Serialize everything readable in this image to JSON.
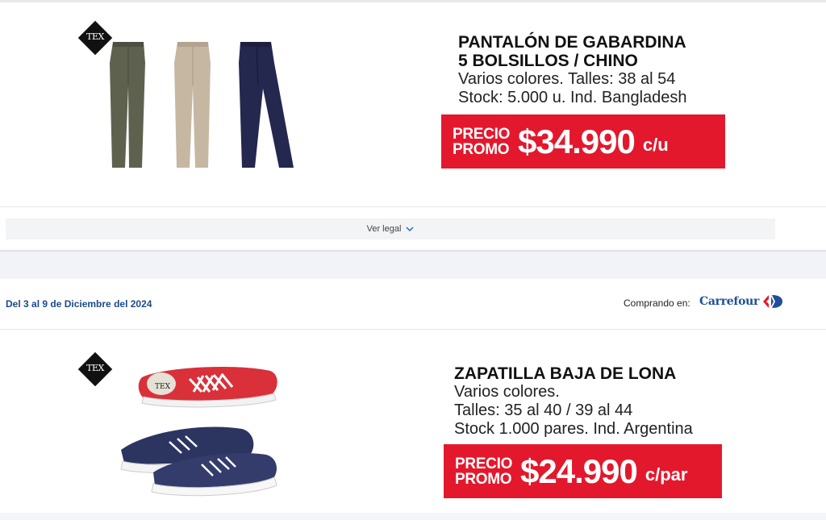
{
  "products": [
    {
      "badge": "TEX",
      "title_line1": "PANTALÓN DE GABARDINA",
      "title_line2": "5 BOLSILLOS / CHINO",
      "desc": [
        "Varios colores. Talles: 38 al 54",
        "Stock: 5.000 u. Ind. Bangladesh"
      ],
      "price_label_1": "PRECIO",
      "price_label_2": "PROMO",
      "price": "$34.990",
      "unit": "c/u",
      "image": "pants-three-colors"
    },
    {
      "badge": "TEX",
      "title_line1": "ZAPATILLA BAJA DE LONA",
      "desc": [
        "Varios colores.",
        "Talles: 35 al 40 / 39 al 44",
        "Stock 1.000 pares. Ind. Argentina"
      ],
      "price_label_1": "PRECIO",
      "price_label_2": "PROMO",
      "price": "$24.990",
      "unit": "c/par",
      "image": "canvas-sneakers"
    }
  ],
  "legal": {
    "label": "Ver legal",
    "icon": "chevron-down-icon"
  },
  "header": {
    "date_range": "Del 3 al 9 de Diciembre del 2024",
    "buying_at": "Comprando en:",
    "store_name": "Carrefour"
  },
  "colors": {
    "promo_red": "#e3182d",
    "date_blue": "#1a4a8a",
    "brand_blue": "#1d4f9b"
  }
}
